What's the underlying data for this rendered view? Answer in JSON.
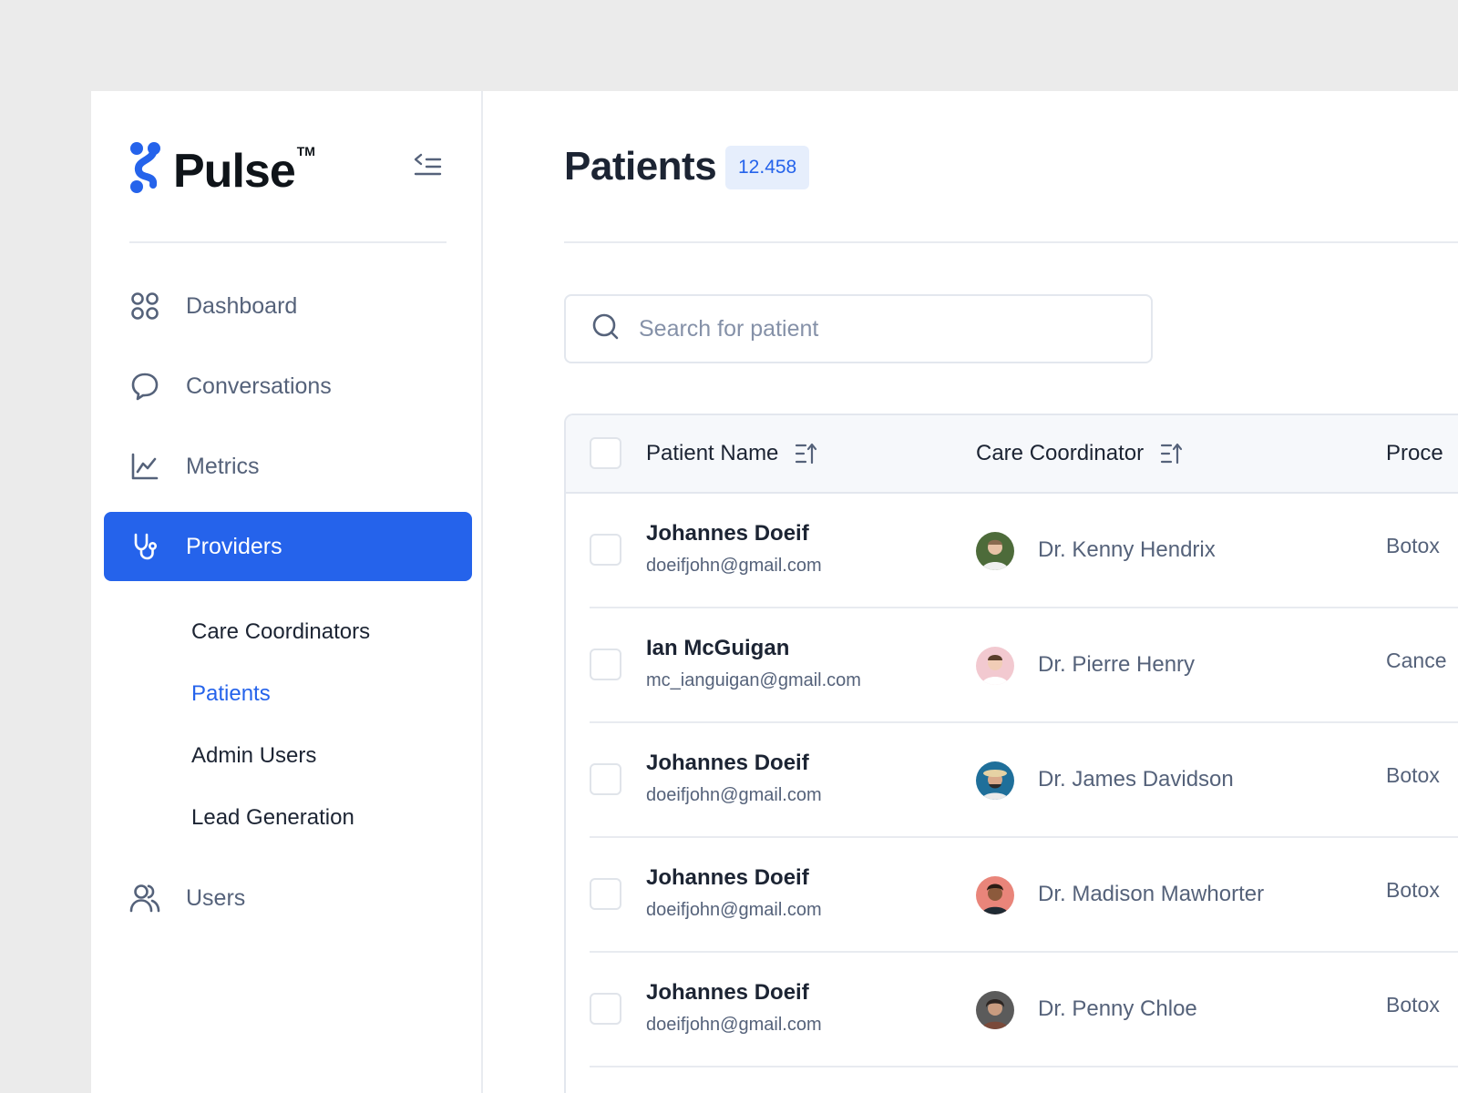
{
  "brand": {
    "name": "Pulse",
    "trademark": "TM",
    "accent_color": "#2563eb"
  },
  "sidebar": {
    "nav": [
      {
        "label": "Dashboard",
        "icon": "dashboard-grid-icon"
      },
      {
        "label": "Conversations",
        "icon": "chat-bubble-icon"
      },
      {
        "label": "Metrics",
        "icon": "line-chart-icon"
      },
      {
        "label": "Providers",
        "icon": "stethoscope-icon",
        "active": true
      },
      {
        "label": "Users",
        "icon": "users-icon"
      }
    ],
    "sub_nav": [
      {
        "label": "Care Coordinators"
      },
      {
        "label": "Patients",
        "active": true
      },
      {
        "label": "Admin Users"
      },
      {
        "label": "Lead Generation"
      }
    ]
  },
  "main": {
    "title": "Patients",
    "count": "12.458",
    "search": {
      "placeholder": "Search for patient",
      "value": ""
    },
    "table": {
      "columns": [
        "Patient Name",
        "Care Coordinator",
        "Proce"
      ],
      "rows": [
        {
          "name": "Johannes Doeif",
          "email": "doeifjohn@gmail.com",
          "coordinator": "Dr. Kenny Hendrix",
          "procedure": "Botox"
        },
        {
          "name": "Ian McGuigan",
          "email": "mc_ianguigan@gmail.com",
          "coordinator": "Dr. Pierre Henry",
          "procedure": "Cance"
        },
        {
          "name": "Johannes Doeif",
          "email": "doeifjohn@gmail.com",
          "coordinator": "Dr. James Davidson",
          "procedure": "Botox"
        },
        {
          "name": "Johannes Doeif",
          "email": "doeifjohn@gmail.com",
          "coordinator": "Dr. Madison Mawhorter",
          "procedure": "Botox"
        },
        {
          "name": "Johannes Doeif",
          "email": "doeifjohn@gmail.com",
          "coordinator": "Dr. Penny Chloe",
          "procedure": "Botox"
        }
      ]
    }
  }
}
